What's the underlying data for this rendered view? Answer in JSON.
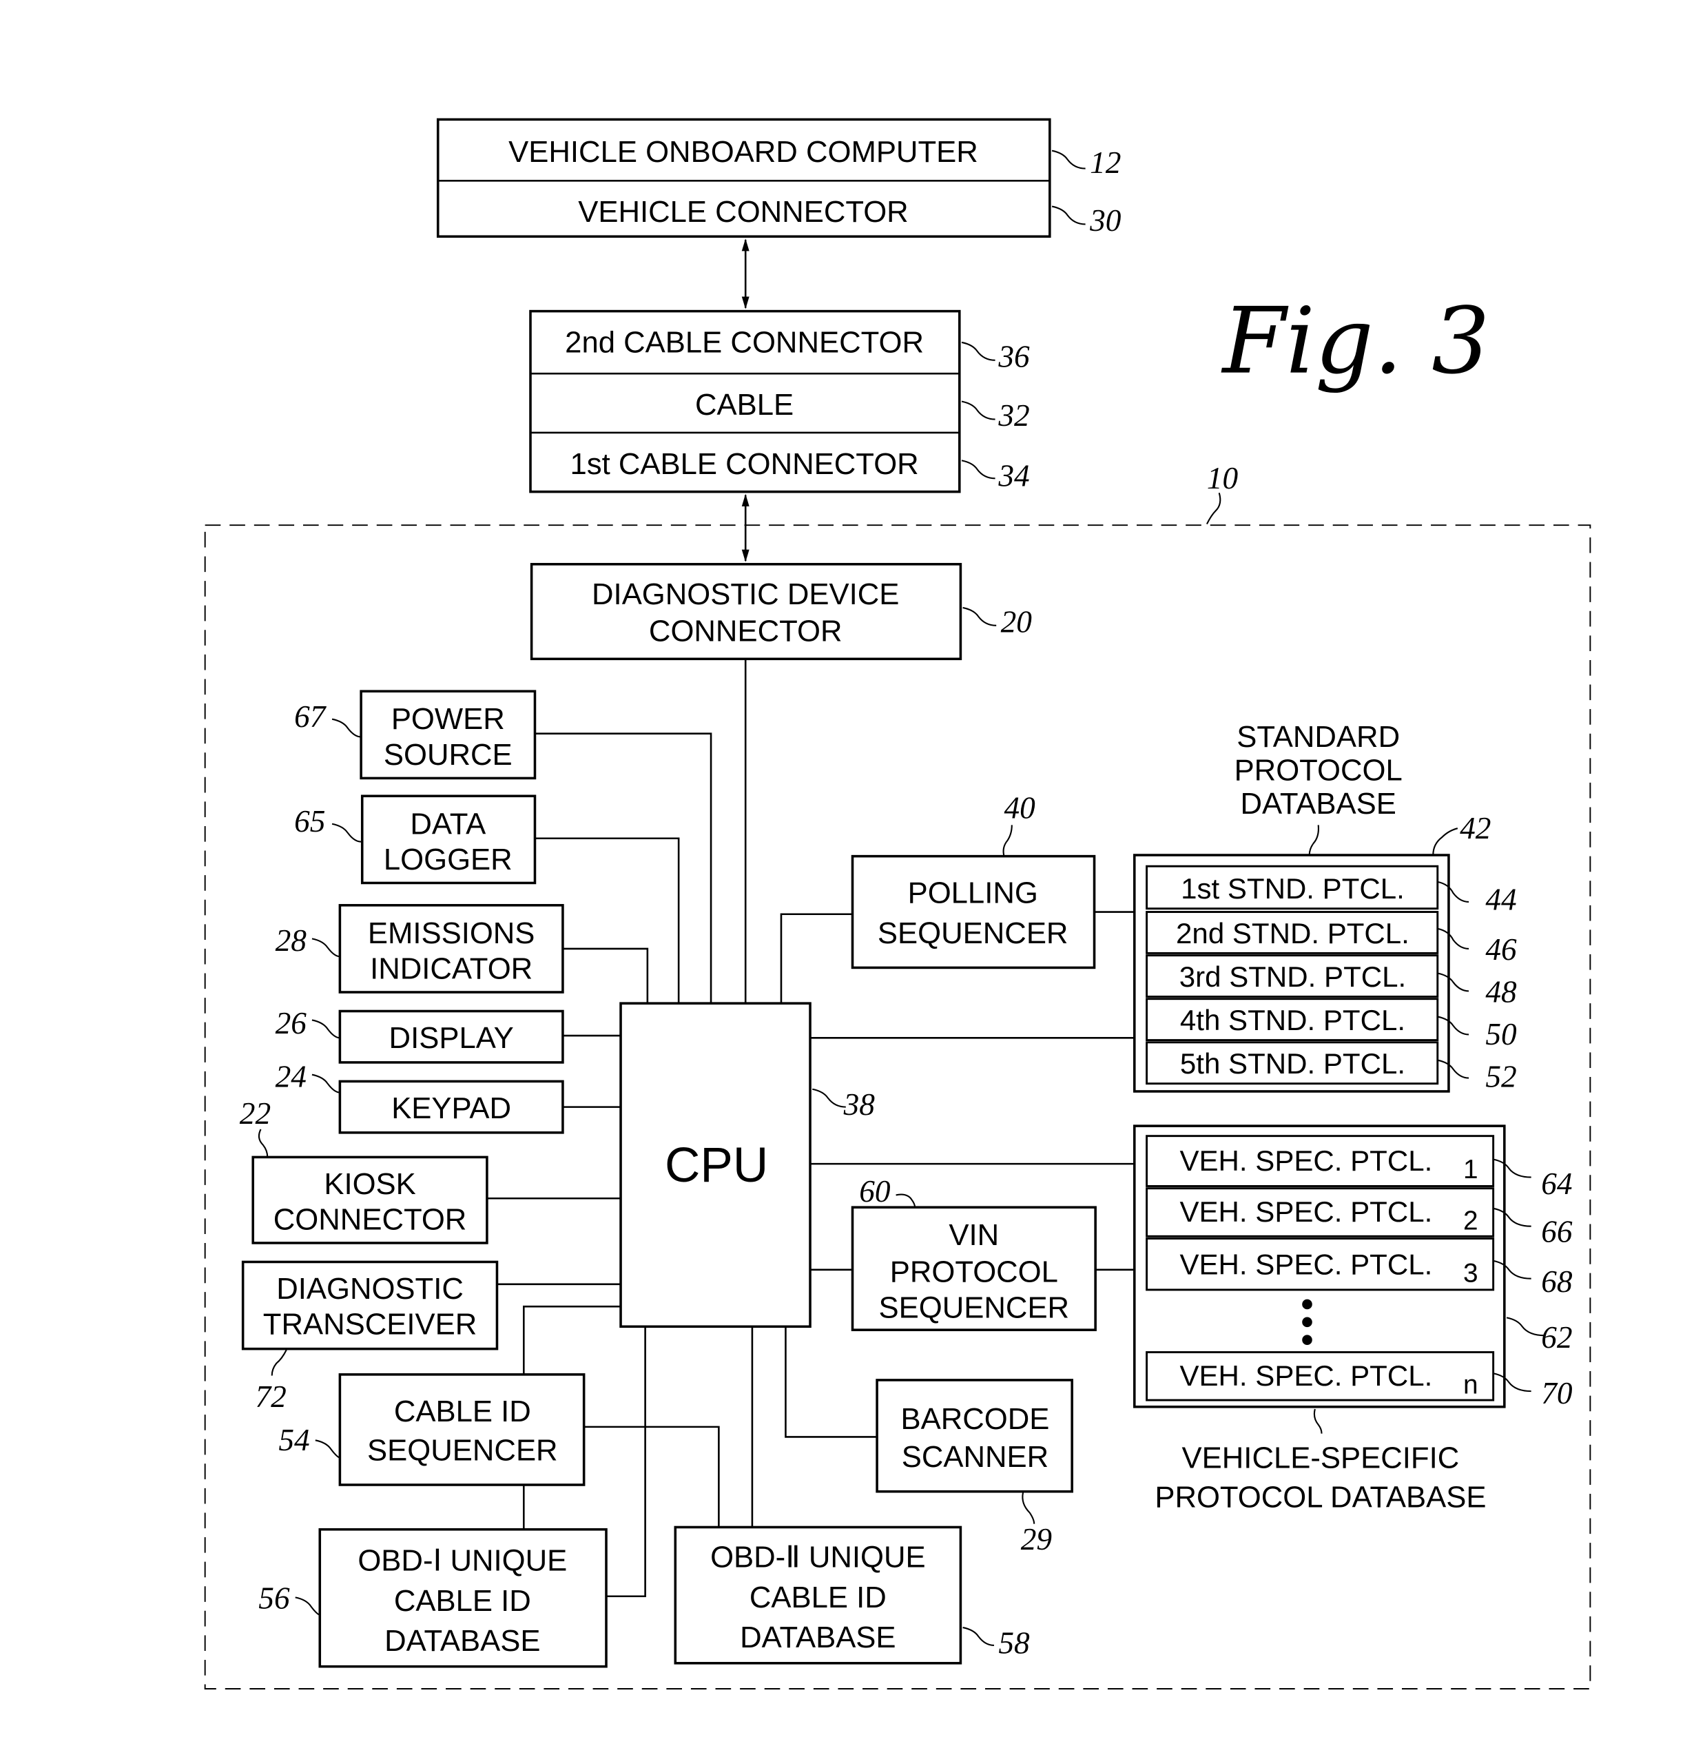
{
  "figure": {
    "title": "Fig. 3"
  },
  "blocks": {
    "vehicle_onboard_computer": {
      "label": "VEHICLE ONBOARD COMPUTER",
      "ref": "12"
    },
    "vehicle_connector": {
      "label": "VEHICLE CONNECTOR",
      "ref": "30"
    },
    "second_cable_connector": {
      "label": "2nd CABLE CONNECTOR",
      "ref": "36"
    },
    "cable": {
      "label": "CABLE",
      "ref": "32"
    },
    "first_cable_connector": {
      "label": "1st CABLE CONNECTOR",
      "ref": "34"
    },
    "diagnostic_device": {
      "ref": "10"
    },
    "diagnostic_device_connector": {
      "lines": [
        "DIAGNOSTIC DEVICE",
        "CONNECTOR"
      ],
      "ref": "20"
    },
    "power_source": {
      "lines": [
        "POWER",
        "SOURCE"
      ],
      "ref": "67"
    },
    "data_logger": {
      "lines": [
        "DATA",
        "LOGGER"
      ],
      "ref": "65"
    },
    "emissions_indicator": {
      "lines": [
        "EMISSIONS",
        "INDICATOR"
      ],
      "ref": "28"
    },
    "display": {
      "label": "DISPLAY",
      "ref": "26"
    },
    "keypad": {
      "label": "KEYPAD",
      "ref": "24"
    },
    "kiosk_connector": {
      "lines": [
        "KIOSK",
        "CONNECTOR"
      ],
      "ref": "22"
    },
    "diagnostic_transceiver": {
      "lines": [
        "DIAGNOSTIC",
        "TRANSCEIVER"
      ],
      "ref": "72"
    },
    "cpu": {
      "label": "CPU",
      "ref": "38"
    },
    "cable_id_sequencer": {
      "lines": [
        "CABLE ID",
        "SEQUENCER"
      ],
      "ref": "54"
    },
    "obd1_database": {
      "lines": [
        "OBD-Ⅰ UNIQUE",
        "CABLE ID",
        "DATABASE"
      ],
      "ref": "56"
    },
    "obd2_database": {
      "lines": [
        "OBD-Ⅱ UNIQUE",
        "CABLE ID",
        "DATABASE"
      ],
      "ref": "58"
    },
    "barcode_scanner": {
      "lines": [
        "BARCODE",
        "SCANNER"
      ],
      "ref": "29"
    },
    "polling_sequencer": {
      "lines": [
        "POLLING",
        "SEQUENCER"
      ],
      "ref": "40"
    },
    "vin_protocol_sequencer": {
      "lines": [
        "VIN",
        "PROTOCOL",
        "SEQUENCER"
      ],
      "ref": "60"
    },
    "standard_protocol_database": {
      "caption": [
        "STANDARD",
        "PROTOCOL",
        "DATABASE"
      ],
      "ref": "42",
      "rows": [
        {
          "label": "1st STND. PTCL.",
          "ref": "44"
        },
        {
          "label": "2nd STND. PTCL.",
          "ref": "46"
        },
        {
          "label": "3rd STND. PTCL.",
          "ref": "48"
        },
        {
          "label": "4th STND. PTCL.",
          "ref": "50"
        },
        {
          "label": "5th STND. PTCL.",
          "ref": "52"
        }
      ]
    },
    "vehicle_specific_protocol_database": {
      "caption": [
        "VEHICLE-SPECIFIC",
        "PROTOCOL DATABASE"
      ],
      "ref": "62",
      "rows": [
        {
          "label": "VEH. SPEC. PTCL.",
          "sub": "1",
          "ref": "64"
        },
        {
          "label": "VEH. SPEC. PTCL.",
          "sub": "2",
          "ref": "66"
        },
        {
          "label": "VEH. SPEC. PTCL.",
          "sub": "3",
          "ref": "68"
        },
        {
          "label": "VEH. SPEC. PTCL.",
          "sub": "n",
          "ref": "70"
        }
      ]
    }
  }
}
